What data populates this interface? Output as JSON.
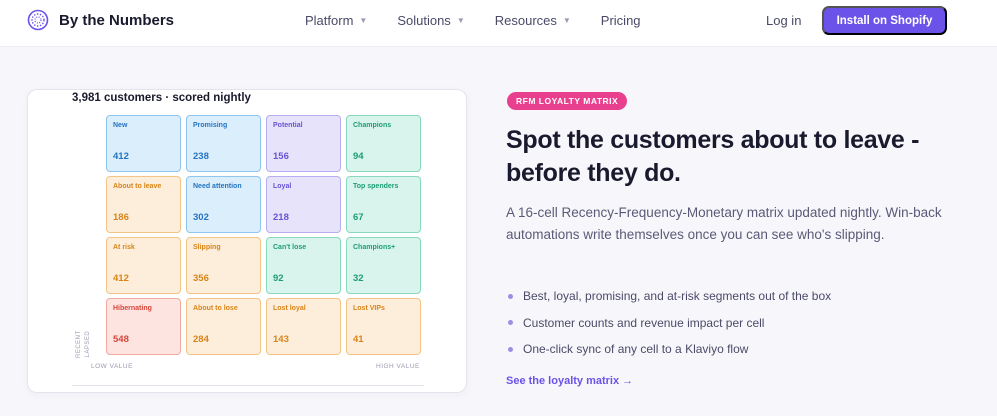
{
  "nav": {
    "brand": "By the Numbers",
    "brand_icon": "dotted-circle-logo-icon",
    "menu": [
      {
        "label": "Platform",
        "has_dropdown": true
      },
      {
        "label": "Solutions",
        "has_dropdown": true
      },
      {
        "label": "Resources",
        "has_dropdown": true
      },
      {
        "label": "Pricing",
        "has_dropdown": false
      }
    ],
    "login_label": "Log in",
    "cta_label": "Install on Shopify",
    "accent_color": "#6b52e8"
  },
  "matrix": {
    "title": "3,981 customers · scored nightly",
    "axis_y_top": "RECENT",
    "axis_y_bottom": "LAPSED",
    "axis_x_left": "LOW VALUE",
    "axis_x_right": "HIGH VALUE",
    "cells": [
      {
        "label": "New",
        "value": "412",
        "tone": "blue"
      },
      {
        "label": "Promising",
        "value": "238",
        "tone": "blue"
      },
      {
        "label": "Potential",
        "value": "156",
        "tone": "purple"
      },
      {
        "label": "Champions",
        "value": "94",
        "tone": "green"
      },
      {
        "label": "About to leave",
        "value": "186",
        "tone": "orange"
      },
      {
        "label": "Need attention",
        "value": "302",
        "tone": "blue"
      },
      {
        "label": "Loyal",
        "value": "218",
        "tone": "purple"
      },
      {
        "label": "Top spenders",
        "value": "67",
        "tone": "green"
      },
      {
        "label": "At risk",
        "value": "412",
        "tone": "orange"
      },
      {
        "label": "Slipping",
        "value": "356",
        "tone": "orange"
      },
      {
        "label": "Can't lose",
        "value": "92",
        "tone": "green"
      },
      {
        "label": "Champions+",
        "value": "32",
        "tone": "green"
      },
      {
        "label": "Hibernating",
        "value": "548",
        "tone": "red"
      },
      {
        "label": "About to lose",
        "value": "284",
        "tone": "orange"
      },
      {
        "label": "Lost loyal",
        "value": "143",
        "tone": "orange"
      },
      {
        "label": "Lost VIPs",
        "value": "41",
        "tone": "orange"
      }
    ]
  },
  "feature": {
    "badge": "RFM LOYALTY MATRIX",
    "badge_color": "#e8408e",
    "headline": "Spot the customers about to leave - before they do.",
    "lead": "A 16-cell Recency-Frequency-Monetary matrix updated nightly. Win-back automations write themselves once you can see who's slipping.",
    "bullets": [
      "Best, loyal, promising, and at-risk segments out of the box",
      "Customer counts and revenue impact per cell",
      "One-click sync of any cell to a Klaviyo flow"
    ],
    "link_label": "See the loyalty matrix →"
  }
}
